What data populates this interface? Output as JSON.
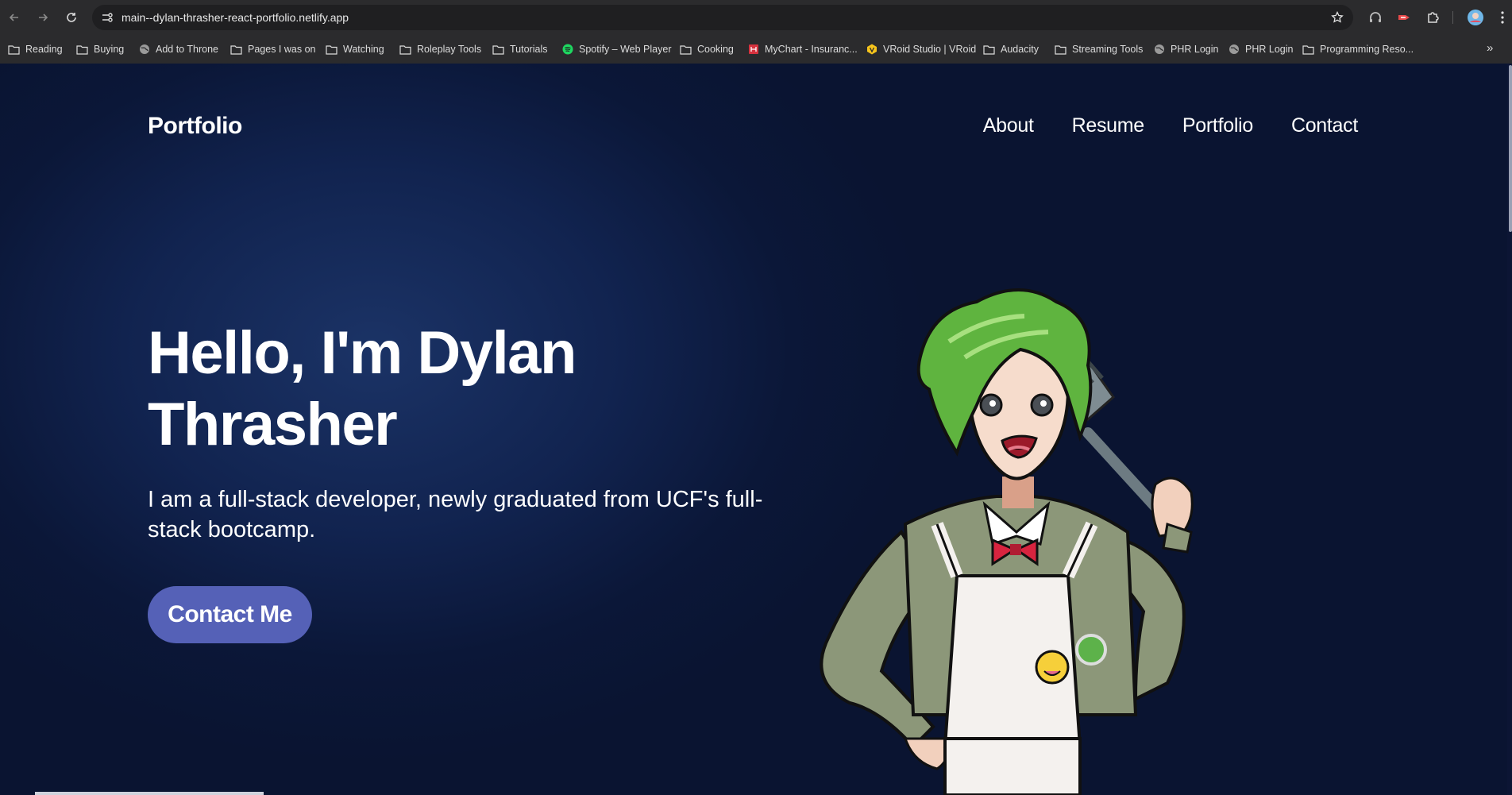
{
  "browser": {
    "url": "main--dylan-thrasher-react-portfolio.netlify.app",
    "bookmarks": [
      {
        "label": "Reading",
        "icon": "folder-icon"
      },
      {
        "label": "Buying",
        "icon": "folder-icon"
      },
      {
        "label": "Add to Throne",
        "icon": "globe-icon"
      },
      {
        "label": "Pages I was on",
        "icon": "folder-icon"
      },
      {
        "label": "Watching",
        "icon": "folder-icon"
      },
      {
        "label": "Roleplay Tools",
        "icon": "folder-icon"
      },
      {
        "label": "Tutorials",
        "icon": "folder-icon"
      },
      {
        "label": "Spotify – Web Player",
        "icon": "spotify-icon"
      },
      {
        "label": "Cooking",
        "icon": "folder-icon"
      },
      {
        "label": "MyChart - Insuranc...",
        "icon": "mychart-icon"
      },
      {
        "label": "VRoid Studio | VRoid",
        "icon": "vroid-icon"
      },
      {
        "label": "Audacity",
        "icon": "folder-icon"
      },
      {
        "label": "Streaming Tools",
        "icon": "folder-icon"
      },
      {
        "label": "PHR Login",
        "icon": "globe-icon"
      },
      {
        "label": "PHR Login",
        "icon": "globe-icon"
      },
      {
        "label": "Programming Reso...",
        "icon": "folder-icon"
      }
    ],
    "more_glyph": "»"
  },
  "site": {
    "brand": "Portfolio",
    "nav": [
      "About",
      "Resume",
      "Portfolio",
      "Contact"
    ],
    "hero": {
      "title": "Hello, I'm Dylan Thrasher",
      "subtitle": "I am a full-stack developer, newly graduated from UCF's full-stack bootcamp.",
      "cta": "Contact Me"
    }
  },
  "colors": {
    "chrome": "#2b2b2d",
    "page_bg": "#0b1738",
    "accent": "#5561b7",
    "text": "#ffffff"
  }
}
